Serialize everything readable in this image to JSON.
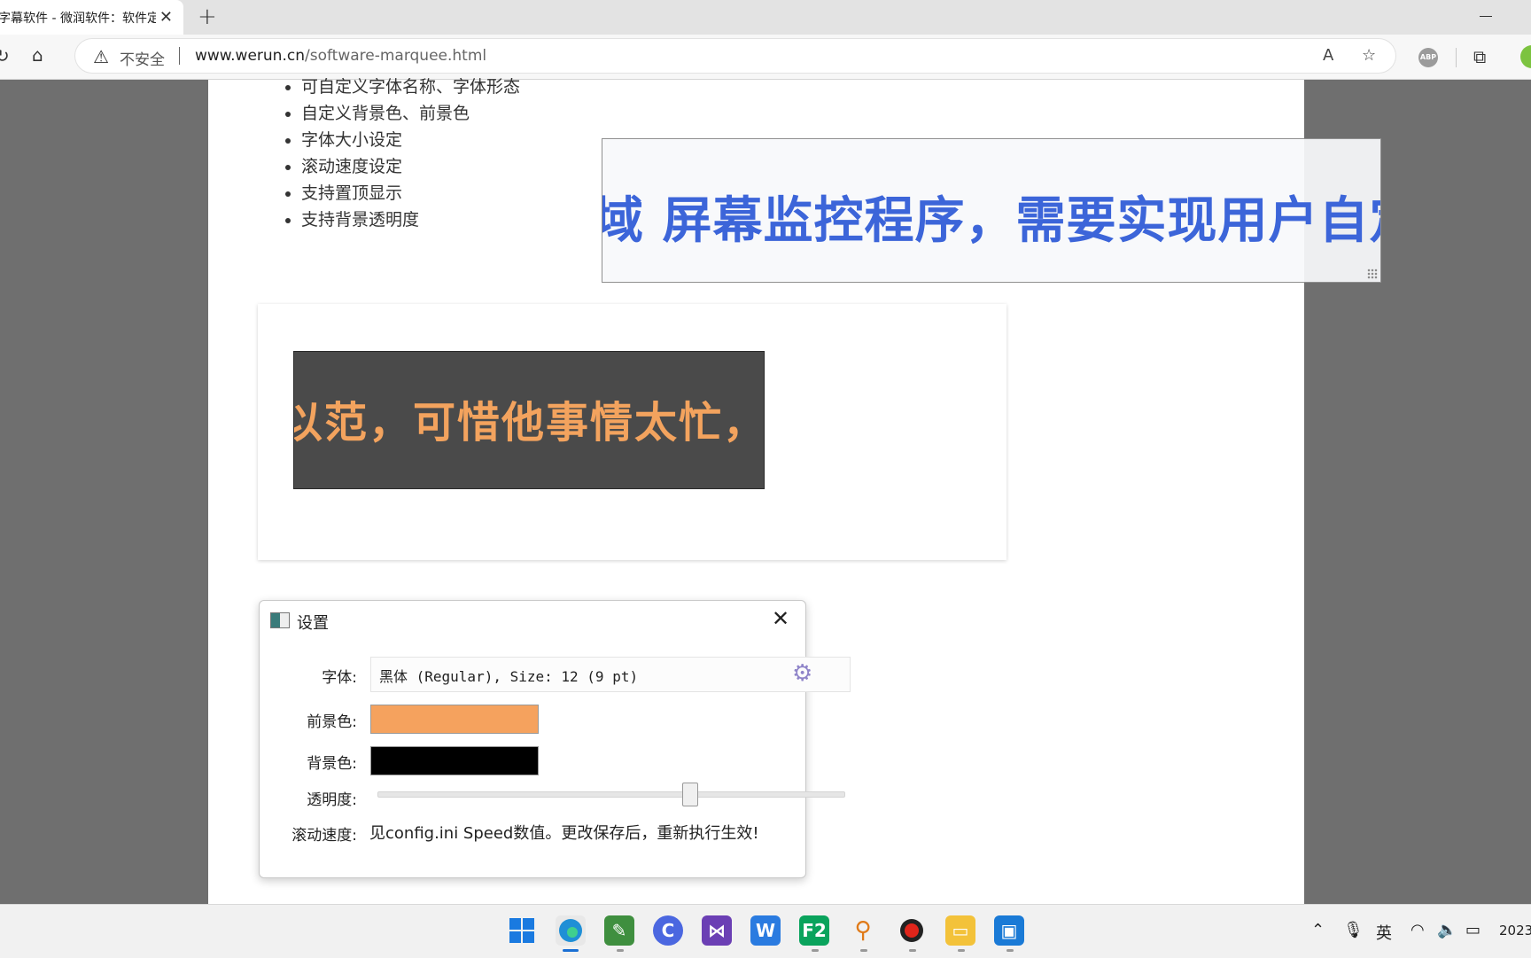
{
  "browser": {
    "tab_title": "字幕软件 - 微润软件：软件定制",
    "insecure_label": "不安全",
    "url_host": "www.werun.cn",
    "url_path": "/software-marquee.html"
  },
  "page": {
    "features": [
      "可自定义字体名称、字体形态",
      "自定义背景色、前景色",
      "字体大小设定",
      "滚动速度设定",
      "支持置顶显示",
      "支持背景透明度"
    ],
    "dark_marquee_text": "以范，可惜他事情太忙，",
    "blue_marquee_text": "域  屏幕监控程序，需要实现用户自定"
  },
  "settings": {
    "title": "设置",
    "font_label": "字体:",
    "font_value": "黑体 (Regular), Size: 12 (9 pt)",
    "fg_label": "前景色:",
    "fg_color": "#f5a25e",
    "bg_label": "背景色:",
    "bg_color": "#000000",
    "opacity_label": "透明度:",
    "opacity_value": 0.66,
    "speed_label": "滚动速度:",
    "speed_text": "见config.ini Speed数值。更改保存后，重新执行生效!"
  },
  "taskbar": {
    "ime": "英",
    "clock": "2023"
  },
  "colors": {
    "blue_text": "#3c65d9",
    "orange_text": "#f3a35e"
  }
}
